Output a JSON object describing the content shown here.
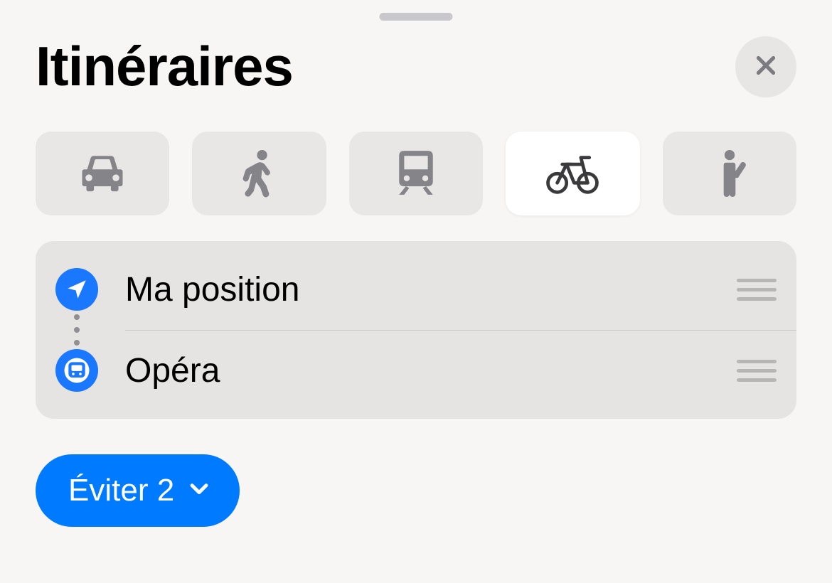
{
  "header": {
    "title": "Itinéraires",
    "close_icon": "close-icon"
  },
  "transport_modes": [
    {
      "id": "car",
      "icon": "car-icon",
      "active": false
    },
    {
      "id": "walk",
      "icon": "walk-icon",
      "active": false
    },
    {
      "id": "transit",
      "icon": "transit-icon",
      "active": false
    },
    {
      "id": "bike",
      "icon": "bike-icon",
      "active": true
    },
    {
      "id": "ride",
      "icon": "ride-icon",
      "active": false
    }
  ],
  "route": {
    "from": {
      "label": "Ma position",
      "icon": "location-arrow-icon"
    },
    "to": {
      "label": "Opéra",
      "icon": "metro-icon"
    }
  },
  "options": {
    "avoid_chip_label": "Éviter 2"
  },
  "colors": {
    "accent": "#007aff",
    "icon_gray": "#848489"
  }
}
